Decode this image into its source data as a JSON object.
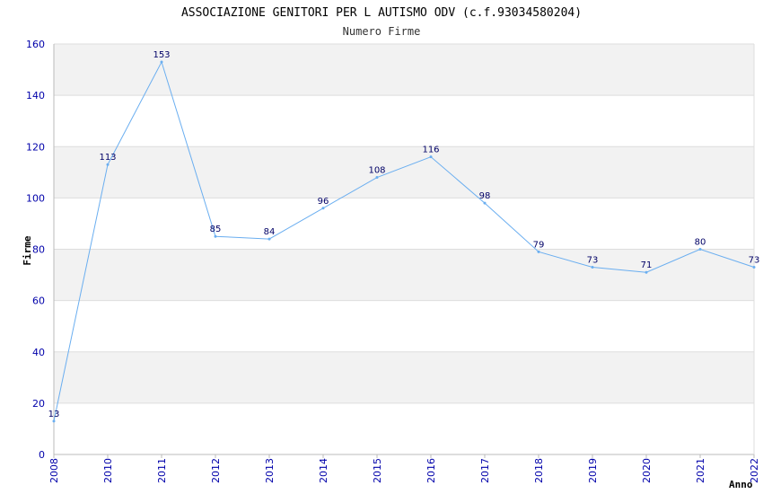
{
  "chart_data": {
    "type": "line",
    "title": "ASSOCIAZIONE GENITORI PER L AUTISMO ODV (c.f.93034580204)",
    "subtitle": "Numero Firme",
    "xlabel": "Anno",
    "ylabel": "Firme",
    "x": [
      "2008",
      "2010",
      "2011",
      "2012",
      "2013",
      "2014",
      "2015",
      "2016",
      "2017",
      "2018",
      "2019",
      "2020",
      "2021",
      "2022"
    ],
    "series": [
      {
        "values": [
          13,
          113,
          153,
          85,
          84,
          96,
          108,
          116,
          98,
          79,
          73,
          71,
          80,
          73
        ]
      }
    ],
    "ylim": [
      0,
      160
    ],
    "yticks": [
      0,
      20,
      40,
      60,
      80,
      100,
      120,
      140,
      160
    ],
    "grid": true,
    "colors": {
      "line": "#6aaef0",
      "band": "#f2f2f2",
      "grid": "#dddddd",
      "tick": "#0000aa",
      "label": "#000066"
    }
  }
}
